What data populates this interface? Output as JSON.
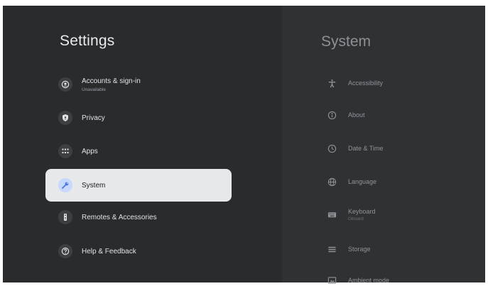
{
  "settings": {
    "title": "Settings",
    "items": [
      {
        "label": "Accounts & sign-in",
        "sublabel": "Unavailable",
        "icon": "account-icon"
      },
      {
        "label": "Privacy",
        "icon": "shield-icon"
      },
      {
        "label": "Apps",
        "icon": "apps-grid-icon"
      },
      {
        "label": "System",
        "icon": "wrench-icon",
        "selected": true
      },
      {
        "label": "Remotes & Accessories",
        "icon": "remote-icon"
      },
      {
        "label": "Help & Feedback",
        "icon": "help-icon"
      }
    ]
  },
  "system": {
    "title": "System",
    "items": [
      {
        "label": "Accessibility",
        "icon": "accessibility-icon"
      },
      {
        "label": "About",
        "icon": "info-icon"
      },
      {
        "label": "Date & Time",
        "icon": "clock-icon"
      },
      {
        "label": "Language",
        "icon": "globe-icon"
      },
      {
        "label": "Keyboard",
        "sublabel": "Gboard",
        "icon": "keyboard-icon"
      },
      {
        "label": "Storage",
        "icon": "storage-icon"
      },
      {
        "label": "Ambient mode",
        "icon": "ambient-mode-icon"
      }
    ]
  },
  "colors": {
    "background": "#292b2d",
    "right_panel": "#2f3133",
    "selected_item": "#e7e8ea",
    "selected_icon_bg": "#c6d8fb",
    "accent": "#4a78d8"
  }
}
